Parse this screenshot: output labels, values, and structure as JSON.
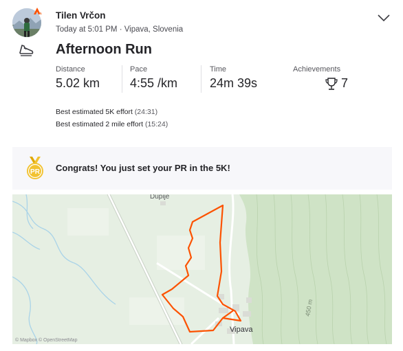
{
  "athlete": {
    "name": "Tilen Vrčon"
  },
  "activity": {
    "meta": "Today at 5:01 PM · Vipava, Slovenia",
    "title": "Afternoon Run",
    "sport_icon": "running-shoe-icon"
  },
  "stats": [
    {
      "label": "Distance",
      "value": "5.02 km"
    },
    {
      "label": "Pace",
      "value": "4:55 /km"
    },
    {
      "label": "Time",
      "value": "24m 39s"
    },
    {
      "label": "Achievements",
      "value": "7"
    }
  ],
  "efforts": [
    {
      "text": "Best estimated 5K effort",
      "detail": "(24:31)"
    },
    {
      "text": "Best estimated 2 mile effort",
      "detail": "(15:24)"
    }
  ],
  "pr_banner": {
    "badge": "PR",
    "message": "Congrats! You just set your PR in the 5K!"
  },
  "map": {
    "labels": {
      "village_north": "Dupije",
      "town": "Vipava",
      "elevation": "450 m"
    },
    "attribution": "© Mapbox © OpenStreetMap",
    "route_color": "#fc5200"
  },
  "colors": {
    "brand": "#fc5200",
    "pr_gold": "#f2c230"
  }
}
